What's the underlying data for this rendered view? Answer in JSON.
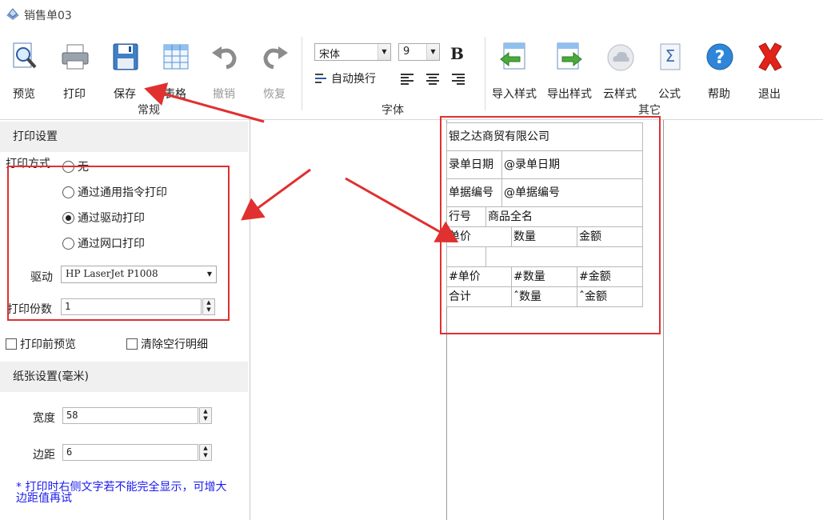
{
  "window": {
    "title": "销售单03"
  },
  "ribbon": {
    "general": {
      "group_label": "常规",
      "buttons": [
        {
          "id": "preview",
          "label": "预览",
          "icon": "magnifier-page-icon",
          "enabled": true
        },
        {
          "id": "print",
          "label": "打印",
          "icon": "printer-icon",
          "enabled": true
        },
        {
          "id": "save",
          "label": "保存",
          "icon": "floppy-disk-icon",
          "enabled": true
        },
        {
          "id": "table",
          "label": "表格",
          "icon": "table-grid-icon",
          "enabled": true
        },
        {
          "id": "undo",
          "label": "撤销",
          "icon": "undo-arrow-icon",
          "enabled": false
        },
        {
          "id": "redo",
          "label": "恢复",
          "icon": "redo-arrow-icon",
          "enabled": false
        }
      ]
    },
    "font": {
      "group_label": "字体",
      "font_name": "宋体",
      "font_size": "9",
      "bold_label": "B",
      "auto_wrap_label": "自动换行"
    },
    "other": {
      "group_label": "其它",
      "buttons": [
        {
          "id": "import_style",
          "label": "导入样式",
          "icon": "import-style-icon"
        },
        {
          "id": "export_style",
          "label": "导出样式",
          "icon": "export-style-icon"
        },
        {
          "id": "cloud_style",
          "label": "云样式",
          "icon": "cloud-icon"
        },
        {
          "id": "formula",
          "label": "公式",
          "icon": "sigma-formula-icon"
        },
        {
          "id": "help",
          "label": "帮助",
          "icon": "help-question-icon"
        },
        {
          "id": "exit",
          "label": "退出",
          "icon": "red-x-exit-icon"
        }
      ]
    }
  },
  "print_settings": {
    "header": "打印设置",
    "mode_label": "打印方式",
    "options": [
      {
        "label": "无",
        "selected": false
      },
      {
        "label": "通过通用指令打印",
        "selected": false
      },
      {
        "label": "通过驱动打印",
        "selected": true
      },
      {
        "label": "通过网口打印",
        "selected": false
      }
    ],
    "driver_label": "驱动",
    "driver_value": "HP LaserJet P1008",
    "copies_label": "打印份数",
    "copies_value": "1",
    "preview_before_print": {
      "label": "打印前预览",
      "checked": false
    },
    "clear_empty_rows": {
      "label": "清除空行明细",
      "checked": false
    }
  },
  "paper_settings": {
    "header": "纸张设置(毫米)",
    "width_label": "宽度",
    "width_value": "58",
    "margin_label": "边距",
    "margin_value": "6",
    "note": "* 打印时右侧文字若不能完全显示，可增大边距值再试"
  },
  "receipt": {
    "company": "银之达商贸有限公司",
    "date_label": "录单日期",
    "date_field": "@录单日期",
    "number_label": "单据编号",
    "number_field": "@单据编号",
    "row_no": "行号",
    "product_name": "商品全名",
    "unit_price": "单价",
    "quantity": "数量",
    "amount": "金额",
    "unit_price_field": "#单价",
    "quantity_field": "#数量",
    "amount_field": "#金额",
    "total_label": "合计",
    "total_quantity": "ˆ数量",
    "total_amount": "ˆ金额"
  },
  "colors": {
    "annotation_red": "#e03030",
    "note_blue": "#1a1aee"
  }
}
